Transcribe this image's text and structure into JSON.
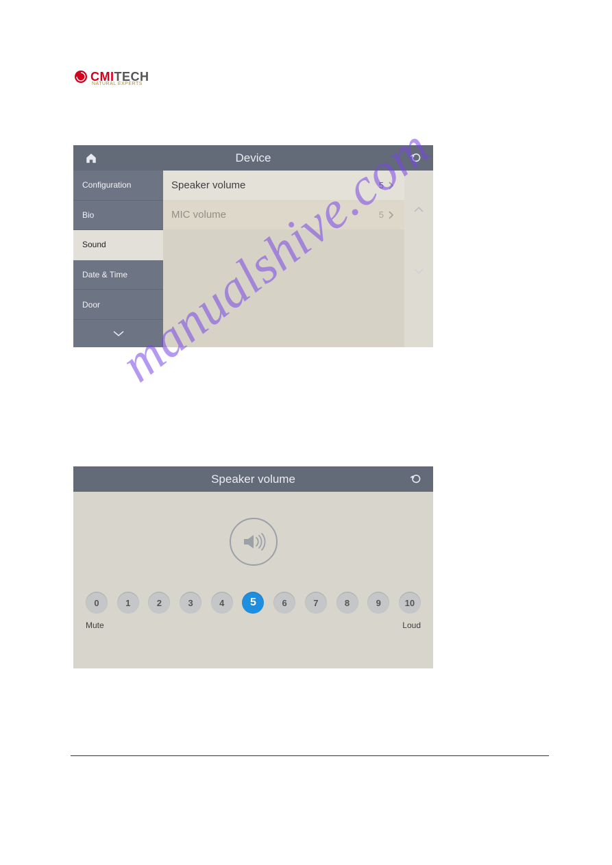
{
  "brand": {
    "cmi": "CMI",
    "tech": "TECH",
    "sub": "NATURAL EXPERTS"
  },
  "watermark": "manualshive.com",
  "device_panel": {
    "title": "Device",
    "sidebar": {
      "items": [
        {
          "label": "Configuration"
        },
        {
          "label": "Bio"
        },
        {
          "label": "Sound"
        },
        {
          "label": "Date & Time"
        },
        {
          "label": "Door"
        }
      ],
      "active_index": 2
    },
    "rows": [
      {
        "label": "Speaker volume",
        "value": "5"
      },
      {
        "label": "MIC volume",
        "value": "5"
      }
    ]
  },
  "volume_panel": {
    "title": "Speaker volume",
    "levels": [
      "0",
      "1",
      "2",
      "3",
      "4",
      "5",
      "6",
      "7",
      "8",
      "9",
      "10"
    ],
    "selected": 5,
    "min_label": "Mute",
    "max_label": "Loud"
  }
}
